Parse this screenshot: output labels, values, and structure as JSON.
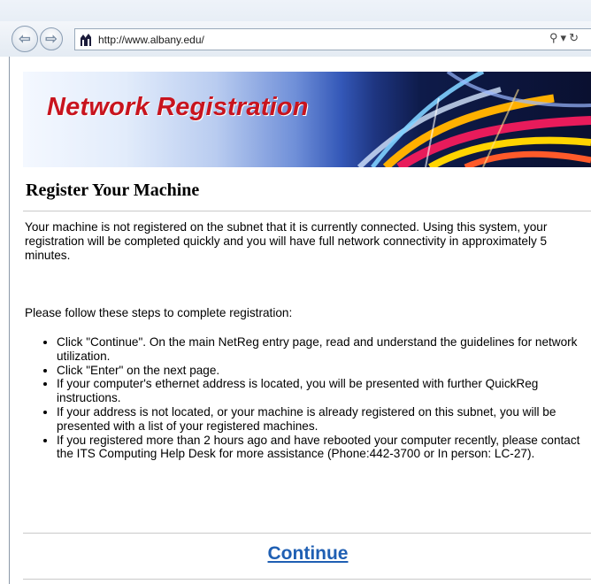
{
  "browser": {
    "back_icon": "back-arrow-icon",
    "forward_icon": "forward-arrow-icon",
    "favicon": "ualbany-favicon",
    "url": "http://www.albany.edu/",
    "search_icon": "search-icon",
    "dropdown_icon": "chevron-down-icon",
    "refresh_icon": "refresh-icon"
  },
  "banner": {
    "title": "Network Registration"
  },
  "page": {
    "heading": "Register Your Machine",
    "intro": "Your machine is not registered on the subnet that it is currently connected. Using this system, your registration will be completed quickly and you will have full network connectivity in approximately 5 minutes.",
    "steps_intro": "Please follow these steps to complete registration:",
    "steps": [
      "Click \"Continue\". On the main NetReg entry page, read and understand the guidelines for network utilization.",
      "Click \"Enter\" on the next page.",
      "If your computer's ethernet address is located, you will be presented with further QuickReg instructions.",
      "If your address is not located, or your machine is already registered on this subnet, you will be presented with a list of your registered machines.",
      "If you registered more than 2 hours ago and have rebooted your computer recently, please contact the ITS Computing Help Desk for more assistance (Phone:442-3700 or In person: LC-27)."
    ],
    "continue_label": "Continue"
  },
  "colors": {
    "banner_title": "#c8141e",
    "link": "#1f5fb3"
  }
}
